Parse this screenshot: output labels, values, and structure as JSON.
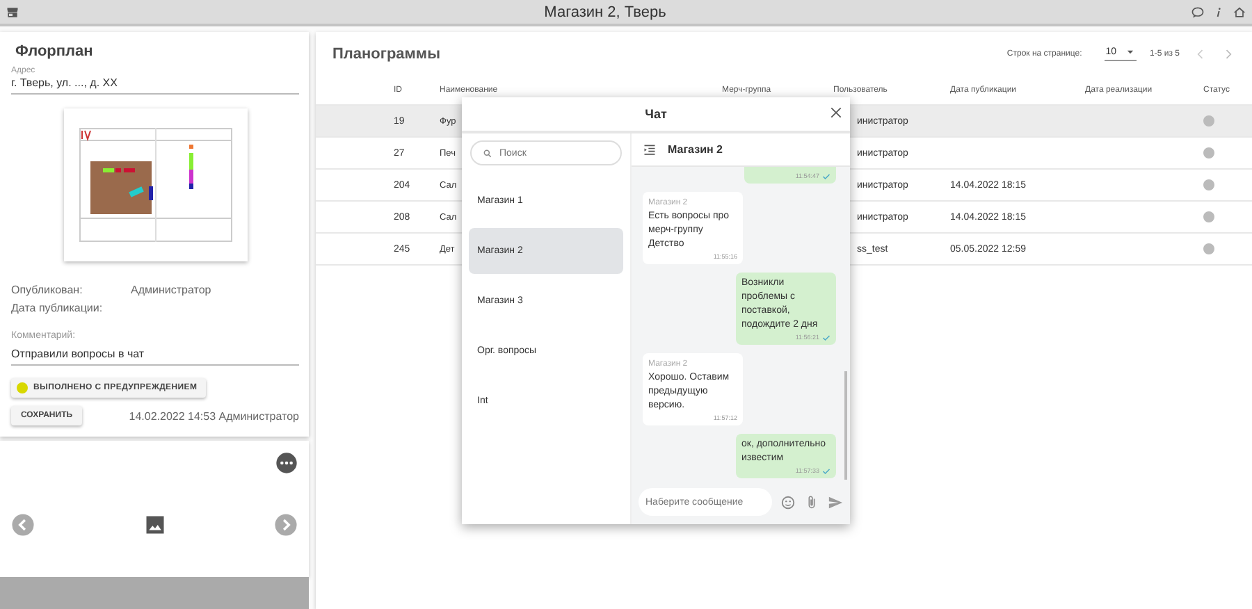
{
  "topbar": {
    "title": "Магазин 2, Тверь"
  },
  "floorplan": {
    "title": "Флорплан",
    "address_label": "Адрес",
    "address": "г. Тверь, ул. ..., д. XX",
    "info": [
      {
        "label": "Опубликован:",
        "value": "Администратор"
      },
      {
        "label": "Дата публикации:"
      }
    ],
    "comment_label": "Комментарий:",
    "comment": "Отправили вопросы в чат",
    "status_button": {
      "label": "ВЫПОЛНЕНО С ПРЕДУПРЕЖДЕНИЕМ",
      "color": "#d8d800"
    },
    "save_button": "СОХРАНИТЬ",
    "saved_info": "14.02.2022 14:53 Администратор"
  },
  "planograms": {
    "title": "Планограммы",
    "rows_per_page_label": "Строк на странице:",
    "rows_per_page": "10",
    "range": "1-5 из 5",
    "columns": [
      "ID",
      "Наименование",
      "Мерч-группа",
      "Пользователь",
      "Дата публикации",
      "Дата реализации",
      "Статус"
    ],
    "rows": [
      {
        "id": "19",
        "name": "Фур",
        "user": "инистратор",
        "published": "",
        "selected": true
      },
      {
        "id": "27",
        "name": "Печ",
        "user": "инистратор",
        "published": "",
        "selected": false
      },
      {
        "id": "204",
        "name": "Сал",
        "user": "инистратор",
        "published": "14.04.2022 18:15",
        "selected": false
      },
      {
        "id": "208",
        "name": "Сал",
        "user": "инистратор",
        "published": "14.04.2022 18:15",
        "selected": false
      },
      {
        "id": "245",
        "name": "Дет",
        "user": "ss_test",
        "published": "05.05.2022 12:59",
        "selected": false
      }
    ]
  },
  "chat": {
    "title": "Чат",
    "search_placeholder": "Поиск",
    "rooms": [
      {
        "name": "Магазин 1",
        "selected": false
      },
      {
        "name": "Магазин 2",
        "selected": true
      },
      {
        "name": "Магазин 3",
        "selected": false
      },
      {
        "name": "Орг. вопросы",
        "selected": false
      },
      {
        "name": "Int",
        "selected": false
      }
    ],
    "room_title": "Магазин 2",
    "messages": [
      {
        "kind": "out",
        "time": "11:54:47"
      },
      {
        "kind": "in",
        "sender": "Магазин 2",
        "text": "Есть вопросы про мерч-группу Детство",
        "time": "11:55:16"
      },
      {
        "kind": "out",
        "text": "Возникли проблемы с поставкой, подождите 2 дня",
        "time": "11:56:21"
      },
      {
        "kind": "in",
        "sender": "Магазин 2",
        "text": "Хорошо. Оставим предыдущую версию.",
        "time": "11:57:12"
      },
      {
        "kind": "out",
        "text": "ок, дополнительно известим",
        "time": "11:57:33"
      }
    ],
    "input_placeholder": "Наберите сообщение"
  }
}
